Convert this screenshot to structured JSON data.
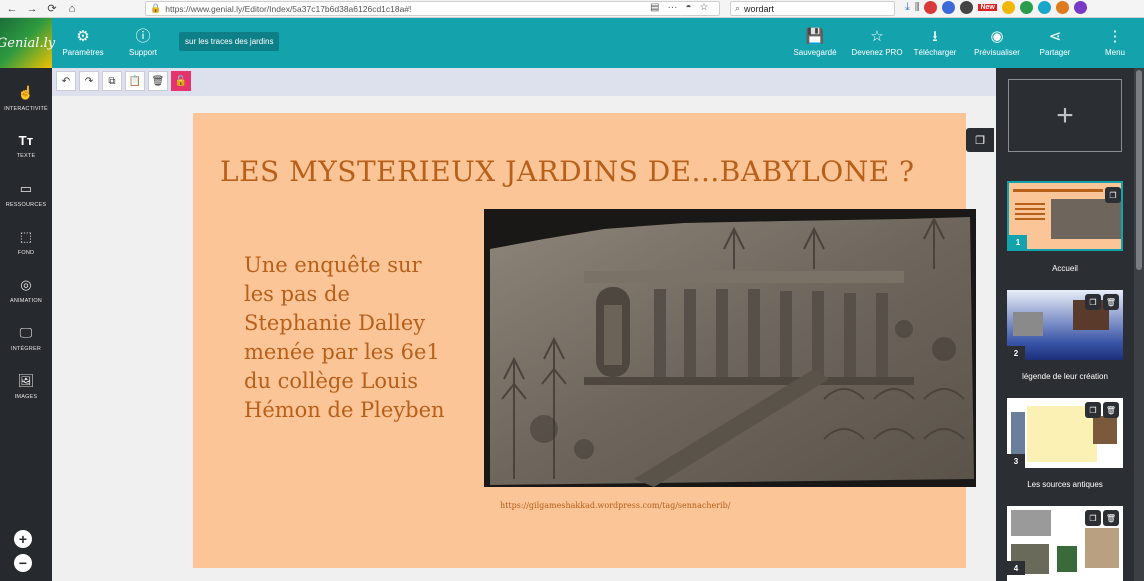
{
  "browser": {
    "url": "https://www.genial.ly/Editor/Index/5a37c17b6d38a6126cd1c18a#!",
    "search_value": "wordart",
    "zoom_badge": "New"
  },
  "app": {
    "logo_text": "Genial.ly",
    "settings_label": "Paramètres",
    "support_label": "Support",
    "project_title": "sur les traces des jardins",
    "saved_label": "Sauvegardé",
    "pro_label": "Devenez PRO",
    "download_label": "Télécharger",
    "preview_label": "Prévisualiser",
    "share_label": "Partager",
    "menu_label": "Menu"
  },
  "sidebar": {
    "items": [
      {
        "label": "INTERACTIVITÉ",
        "icon": "pointer-icon"
      },
      {
        "label": "TEXTE",
        "icon": "text-icon"
      },
      {
        "label": "RESSOURCES",
        "icon": "resources-icon"
      },
      {
        "label": "FOND",
        "icon": "background-icon"
      },
      {
        "label": "ANIMATION",
        "icon": "animation-icon"
      },
      {
        "label": "INTÉGRER",
        "icon": "embed-icon"
      },
      {
        "label": "IMAGES",
        "icon": "image-icon"
      }
    ],
    "zoom_in": "+",
    "zoom_out": "−"
  },
  "slide": {
    "title": "LES MYSTERIEUX JARDINS DE...BABYLONE ?",
    "body_lines": [
      "Une enquête sur",
      "les pas de",
      "Stephanie Dalley",
      "menée par les 6e1",
      "du collège Louis",
      "Hémon de Pleyben"
    ],
    "caption": "https://gilgameshakkad.wordpress.com/tag/sennacherib/"
  },
  "pages": [
    {
      "number": "1",
      "label": "Accueil"
    },
    {
      "number": "2",
      "label": "légende de leur création"
    },
    {
      "number": "3",
      "label": "Les sources antiques"
    },
    {
      "number": "4",
      "label": ""
    }
  ],
  "colors": {
    "accent": "#14a3ad",
    "slide_bg": "#fbc597",
    "slide_text": "#b8601a",
    "pink": "#e5336e"
  }
}
